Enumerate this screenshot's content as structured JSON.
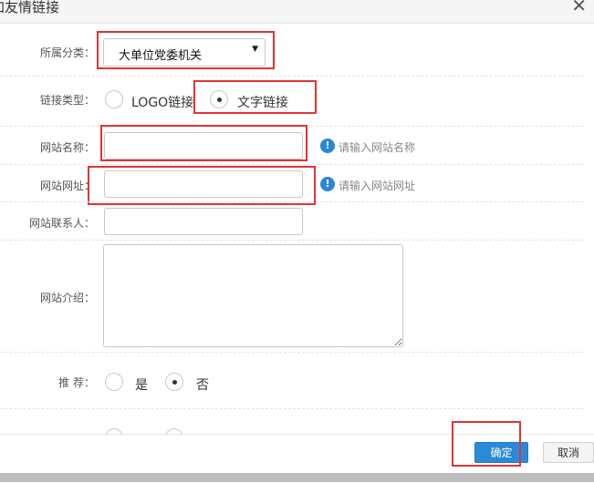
{
  "dialog": {
    "title": "加友情链接",
    "close_label": "✕"
  },
  "form": {
    "category": {
      "label": "所属分类：",
      "value": "大单位党委机关",
      "caret": "▼"
    },
    "link_type": {
      "label": "链接类型：",
      "options": [
        {
          "text": "LOGO链接",
          "selected": false
        },
        {
          "text": "文字链接",
          "selected": true
        }
      ]
    },
    "site_name": {
      "label": "网站名称：",
      "value": "",
      "hint": "请输入网站名称"
    },
    "site_url": {
      "label": "网站网址：",
      "value": "",
      "hint": "请输入网站网址"
    },
    "contact": {
      "label": "网站联系人：",
      "value": ""
    },
    "intro": {
      "label": "网站介绍：",
      "value": ""
    },
    "recommend": {
      "label": "推 荐：",
      "options": [
        {
          "text": "是",
          "selected": false
        },
        {
          "text": "否",
          "selected": true
        }
      ]
    }
  },
  "icons": {
    "info": "!"
  },
  "footer": {
    "confirm_label": "确定",
    "cancel_label": "取消"
  }
}
